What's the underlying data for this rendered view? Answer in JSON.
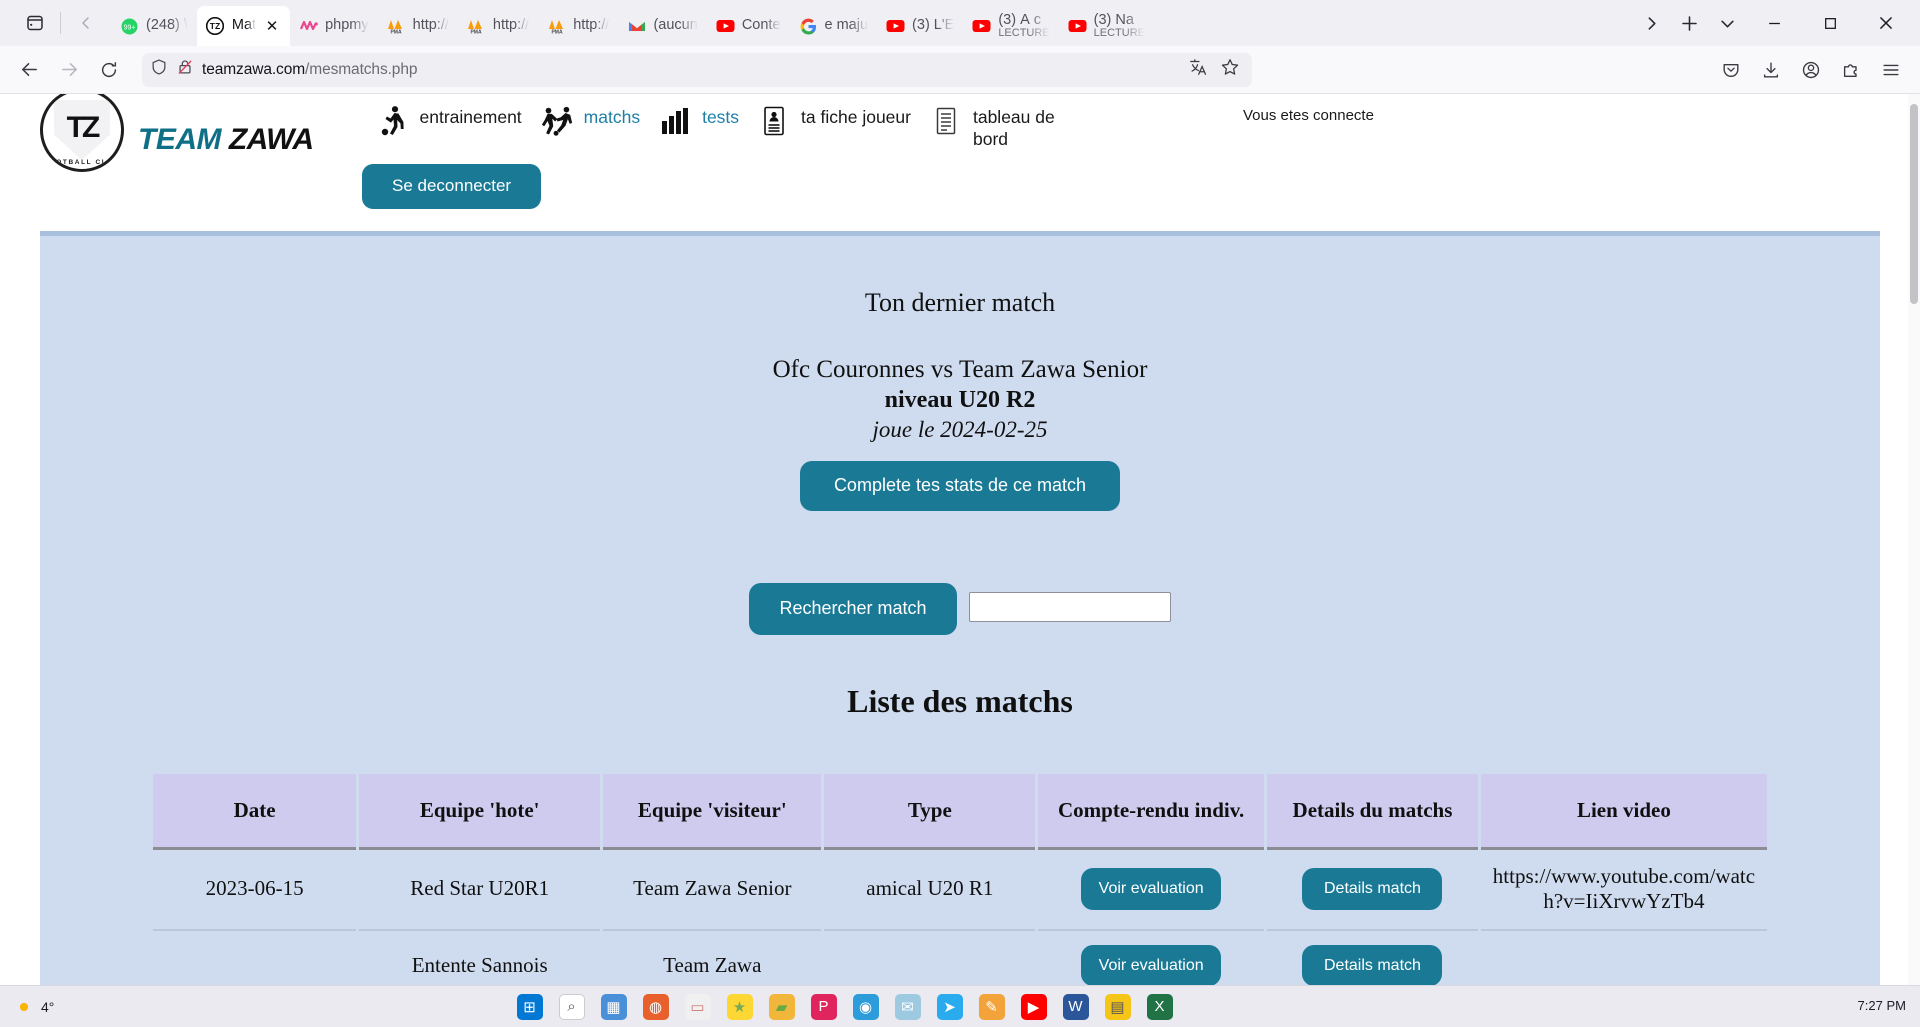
{
  "browser": {
    "tabs": [
      {
        "label": "(248) \\",
        "favicon": "whatsapp-icon",
        "active": false,
        "color": "#25d366"
      },
      {
        "label": "Mat",
        "sub": "",
        "favicon": "teamzawa-icon",
        "active": true,
        "color": "#111111"
      },
      {
        "label": "phpmy",
        "favicon": "phpmyadmin-icon",
        "active": false,
        "color": "#e8468f"
      },
      {
        "label": "http://",
        "favicon": "pma-icon",
        "active": false,
        "color": "#f89c0e"
      },
      {
        "label": "http://",
        "favicon": "pma-icon",
        "active": false,
        "color": "#f89c0e"
      },
      {
        "label": "http://",
        "favicon": "pma-icon",
        "active": false,
        "color": "#f89c0e"
      },
      {
        "label": "(aucun",
        "favicon": "gmail-icon",
        "active": false,
        "color": "#ea4335"
      },
      {
        "label": "Conte",
        "favicon": "youtube-icon",
        "active": false,
        "color": "#ff0000"
      },
      {
        "label": "e maju",
        "favicon": "google-icon",
        "active": false,
        "color": "#4285f4"
      },
      {
        "label": "(3) L'E",
        "favicon": "youtube-icon",
        "active": false,
        "color": "#ff0000"
      },
      {
        "label": "(3) À c",
        "sub": "LECTURE",
        "favicon": "youtube-icon",
        "active": false,
        "color": "#ff0000"
      },
      {
        "label": "(3) Na",
        "sub": "LECTURE",
        "favicon": "youtube-icon",
        "active": false,
        "color": "#ff0000"
      }
    ],
    "url_domain": "teamzawa.com",
    "url_path": "/mesmatchs.php",
    "new_tab_label": "+",
    "icons": {
      "tab_list": "vertical-tabs-icon",
      "scroll_left": "chevron-left-icon",
      "scroll_right": "chevron-right-icon",
      "tab_dropdown": "chevron-down-icon",
      "minimize": "minimize-icon",
      "maximize": "maximize-icon",
      "close": "close-icon",
      "back": "back-arrow-icon",
      "forward": "forward-arrow-icon",
      "reload": "reload-icon",
      "shield": "shield-icon",
      "no_lock": "lock-crossed-icon",
      "translate": "translate-icon",
      "bookmark": "star-icon",
      "pocket": "pocket-icon",
      "downloads": "download-icon",
      "account": "account-icon",
      "extensions": "extensions-icon",
      "menu": "hamburger-menu-icon"
    }
  },
  "site": {
    "brand_part1": "TEAM",
    "brand_part2": "ZAWA",
    "logo_mark": "TZ",
    "logo_arc": "FOOTBALL CLUB",
    "nav": [
      {
        "label": "entrainement",
        "icon": "player-kick-icon",
        "active": false
      },
      {
        "label": "matchs",
        "icon": "players-duel-icon",
        "active": true
      },
      {
        "label": "tests",
        "icon": "bar-chart-icon",
        "active": false
      },
      {
        "label": "ta fiche joueur",
        "icon": "id-card-icon",
        "active": false
      },
      {
        "label": "tableau de bord",
        "icon": "document-icon",
        "active": false
      }
    ],
    "connected_text": "Vous etes connecte",
    "logout_label": "Se deconnecter",
    "accent_color": "#1a7a96",
    "panel_bg": "#cfdcef",
    "table_header_bg": "#cfcbee"
  },
  "main": {
    "last_match_heading": "Ton dernier match",
    "last_match_teams": "Ofc Couronnes vs Team Zawa Senior",
    "last_match_level": "niveau  U20 R2",
    "last_match_date": "joue le 2024-02-25",
    "complete_stats_label": "Complete tes stats de ce match",
    "search_button_label": "Rechercher match",
    "search_input_value": "",
    "search_input_placeholder": "",
    "list_heading": "Liste des matchs"
  },
  "table": {
    "columns": [
      "Date",
      "Equipe 'hote'",
      "Equipe 'visiteur'",
      "Type",
      "Compte-rendu indiv.",
      "Details du matchs",
      "Lien video"
    ],
    "rows": [
      {
        "date": "2023-06-15",
        "home": "Red Star U20R1",
        "away": "Team Zawa Senior",
        "type": "amical U20 R1",
        "cr_label": "Voir evaluation",
        "details_label": "Details match",
        "video": "https://www.youtube.com/watch?v=IiXrvwYzTb4"
      },
      {
        "date": "",
        "home": "Entente Sannois",
        "away": "Team Zawa",
        "type": "",
        "cr_label": "Voir evaluation",
        "details_label": "Details match",
        "video": ""
      }
    ]
  },
  "taskbar": {
    "weather": "4°",
    "clock_time": "7:27 PM",
    "icons": [
      "start-icon",
      "search-icon",
      "widgets-icon",
      "chat-icon",
      "explorer-icon",
      "store-icon",
      "edge-icon",
      "mail-icon",
      "calendar-icon",
      "telegram-icon",
      "pencil-icon",
      "youtube-icon",
      "word-icon",
      "notes-icon",
      "excel-icon"
    ]
  }
}
